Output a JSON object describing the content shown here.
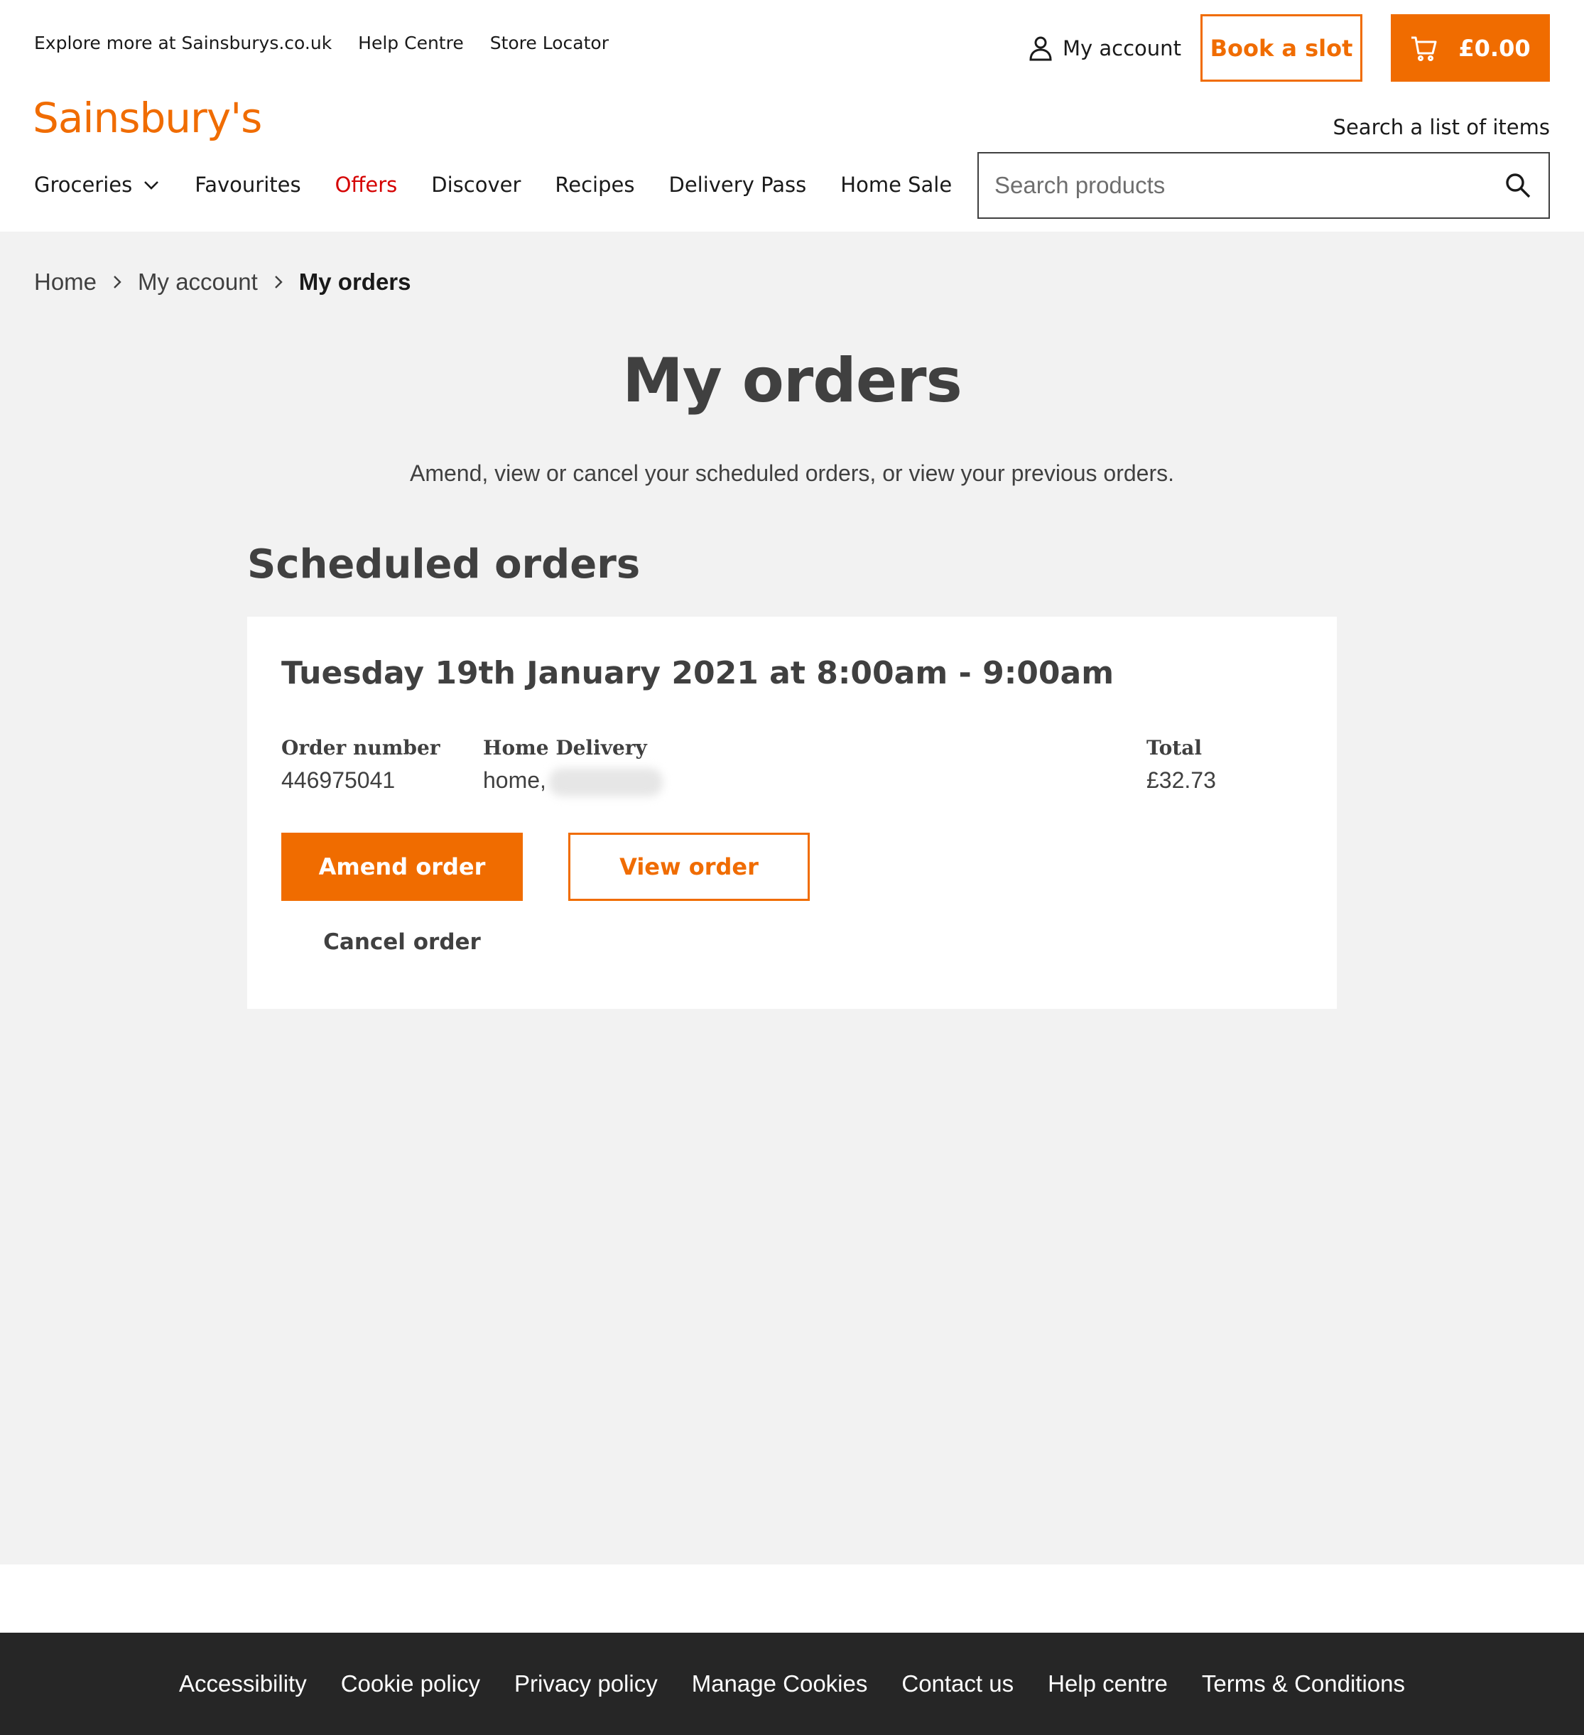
{
  "header": {
    "util_links": [
      "Explore more at Sainsburys.co.uk",
      "Help Centre",
      "Store Locator"
    ],
    "account_label": "My account",
    "book_slot_label": "Book a slot",
    "basket_total": "£0.00",
    "logo_text": "Sainsbury's",
    "search_list_label": "Search a list of items",
    "search_placeholder": "Search products",
    "nav": [
      "Groceries",
      "Favourites",
      "Offers",
      "Discover",
      "Recipes",
      "Delivery Pass",
      "Home Sale"
    ],
    "accent_color": "#f06c00",
    "offers_color": "#d50000"
  },
  "breadcrumb": [
    "Home",
    "My account",
    "My orders"
  ],
  "main": {
    "title": "My orders",
    "subtitle": "Amend, view or cancel your scheduled orders, or view your previous orders.",
    "section_title": "Scheduled orders",
    "order": {
      "slot": "Tuesday 19th January 2021 at 8:00am - 9:00am",
      "order_number_label": "Order number",
      "order_number": "446975041",
      "delivery_label": "Home Delivery",
      "delivery_address": "home,",
      "total_label": "Total",
      "total": "£32.73",
      "amend_label": "Amend order",
      "view_label": "View order",
      "cancel_label": "Cancel order"
    }
  },
  "footer": {
    "links": [
      "Accessibility",
      "Cookie policy",
      "Privacy policy",
      "Manage Cookies",
      "Contact us",
      "Help centre",
      "Terms & Conditions"
    ],
    "background": "#262626"
  }
}
